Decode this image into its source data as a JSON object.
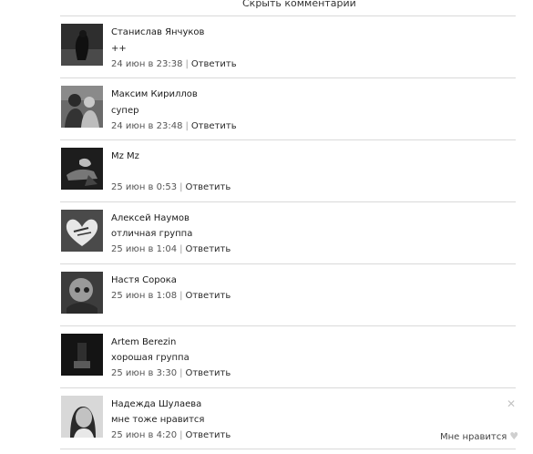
{
  "header": {
    "hide_comments": "Скрыть комментарии"
  },
  "comments": [
    {
      "author": "Станислав Янчуков",
      "text": "++",
      "date": "24 июн в 23:38",
      "reply": "Ответить"
    },
    {
      "author": "Максим Кириллов",
      "text": "супер",
      "date": "24 июн в 23:48",
      "reply": "Ответить"
    },
    {
      "author": "Mz Mz",
      "text": "",
      "date": "25 июн в 0:53",
      "reply": "Ответить"
    },
    {
      "author": "Алексей Наумов",
      "text": "отличная группа",
      "date": "25 июн в 1:04",
      "reply": "Ответить"
    },
    {
      "author": "Настя Сорока",
      "text": "",
      "date": "25 июн в 1:08",
      "reply": "Ответить"
    },
    {
      "author": "Artem Berezin",
      "text": "хорошая группа",
      "date": "25 июн в 3:30",
      "reply": "Ответить"
    },
    {
      "author": "Надежда Шулаева",
      "text": "мне тоже нравится",
      "date": "25 июн в 4:20",
      "reply": "Ответить",
      "like_label": "Мне нравится"
    }
  ],
  "icons": {
    "heart": "heart-icon",
    "close": "close-icon"
  }
}
